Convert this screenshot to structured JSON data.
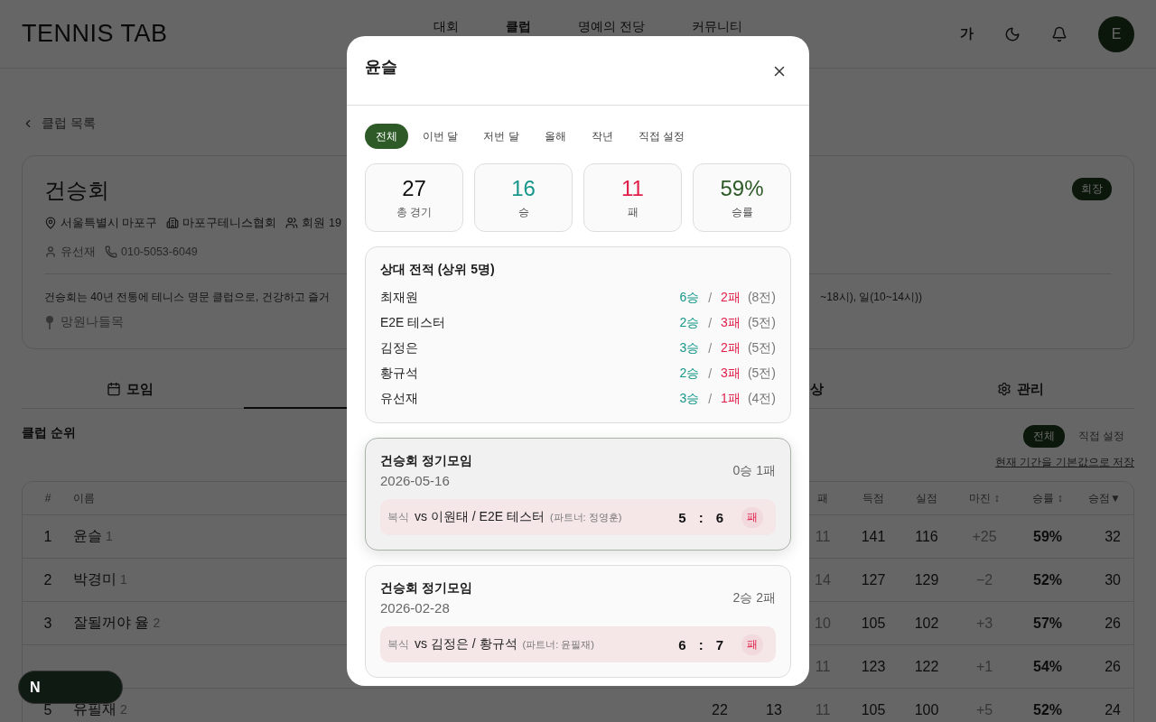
{
  "header": {
    "logo": "TENNIS TAB",
    "nav": [
      {
        "label": "대회",
        "selected": false
      },
      {
        "label": "클럽",
        "selected": true
      },
      {
        "label": "명예의 전당",
        "selected": false
      },
      {
        "label": "커뮤니티",
        "selected": false
      }
    ],
    "font_toggle": "가",
    "avatar": "E"
  },
  "back_link": "클럽 목록",
  "club": {
    "name": "건승회",
    "badge": "회장",
    "location": "서울특별시 마포구",
    "association": "마포구테니스협회",
    "members": "회원 19",
    "leader": "유선재",
    "phone": "010-5053-6049",
    "description_start": "건승회는 40년 전통에 테니스 명문 클럽으로, 건강하고 즐거",
    "description_end": "~18시), 일(10~14시))",
    "place": "망원나들목"
  },
  "tabs": [
    {
      "label": "모임",
      "selected": false
    },
    {
      "selected": true
    },
    {
      "label": "상",
      "selected": false,
      "kind": "clipped"
    },
    {
      "label": "관리",
      "selected": false
    }
  ],
  "ranking": {
    "title": "클럽 순위",
    "periods": [
      {
        "label": "전체",
        "selected": true
      },
      {
        "label": "직접 설정",
        "selected": false
      }
    ],
    "save_link": "현재 기간을 기본값으로 저장",
    "columns": [
      "#",
      "이름",
      "",
      "",
      "패",
      "득점",
      "실점",
      "마진 ↕",
      "승률 ↕",
      "승점▼"
    ],
    "rows": [
      {
        "grade": "1",
        "cells": [
          "1",
          "윤슬",
          "",
          "",
          "11",
          "141",
          "116",
          "+25",
          "59%",
          "32"
        ]
      },
      {
        "grade": "1",
        "cells": [
          "2",
          "박경미",
          "",
          "",
          "14",
          "127",
          "129",
          "−2",
          "52%",
          "30"
        ]
      },
      {
        "grade": "2",
        "cells": [
          "3",
          "잘될꺼야 율",
          "",
          "",
          "10",
          "105",
          "102",
          "+3",
          "57%",
          "26"
        ]
      },
      {
        "cells": [
          "",
          "",
          "",
          "",
          "11",
          "123",
          "122",
          "+1",
          "54%",
          "26"
        ]
      },
      {
        "grade": "2",
        "cells": [
          "5",
          "유필재",
          "22",
          "13",
          "11",
          "105",
          "100",
          "+5",
          "52%",
          "24"
        ]
      }
    ]
  },
  "modal": {
    "title": "윤슬",
    "periods": [
      {
        "label": "전체",
        "selected": true
      },
      {
        "label": "이번 달",
        "selected": false
      },
      {
        "label": "저번 달",
        "selected": false
      },
      {
        "label": "올해",
        "selected": false
      },
      {
        "label": "작년",
        "selected": false
      },
      {
        "label": "직접 설정",
        "selected": false
      }
    ],
    "stats": [
      {
        "kind": "total",
        "value": "27",
        "label": "총 경기"
      },
      {
        "kind": "win",
        "value": "16",
        "label": "승"
      },
      {
        "kind": "loss",
        "value": "11",
        "label": "패"
      },
      {
        "kind": "rate",
        "value": "59%",
        "label": "승률"
      }
    ],
    "head_to_head": {
      "title": "상대 전적 (상위 5명)",
      "rows": [
        {
          "name": "최재원",
          "wins": "6승",
          "separator": "/",
          "losses": "2패",
          "total": "(8전)"
        },
        {
          "name": "E2E 테스터",
          "wins": "2승",
          "separator": "/",
          "losses": "3패",
          "total": "(5전)"
        },
        {
          "name": "김정은",
          "wins": "3승",
          "separator": "/",
          "losses": "2패",
          "total": "(5전)"
        },
        {
          "name": "황규석",
          "wins": "2승",
          "separator": "/",
          "losses": "3패",
          "total": "(5전)"
        },
        {
          "name": "유선재",
          "wins": "3승",
          "separator": "/",
          "losses": "1패",
          "total": "(4전)"
        }
      ]
    },
    "meetings": [
      {
        "title": "건승회 정기모임",
        "date": "2026-05-16",
        "record": "0승 1패",
        "selected": true,
        "games": [
          {
            "type": "복식",
            "opponents": "vs 이원태 / E2E 테스터",
            "partner": "(파트너: 정영훈)",
            "score_a": "5",
            "score_sep": ":",
            "score_b": "6",
            "result": "패",
            "kind": "loss"
          }
        ]
      },
      {
        "title": "건승회 정기모임",
        "date": "2026-02-28",
        "record": "2승 2패",
        "selected": false,
        "games": [
          {
            "type": "복식",
            "opponents": "vs 김정은 / 황규석",
            "partner": "(파트너: 윤필재)",
            "score_a": "6",
            "score_sep": ":",
            "score_b": "7",
            "result": "패",
            "kind": "loss"
          }
        ]
      }
    ]
  },
  "dev_badge": {
    "label": "N"
  }
}
